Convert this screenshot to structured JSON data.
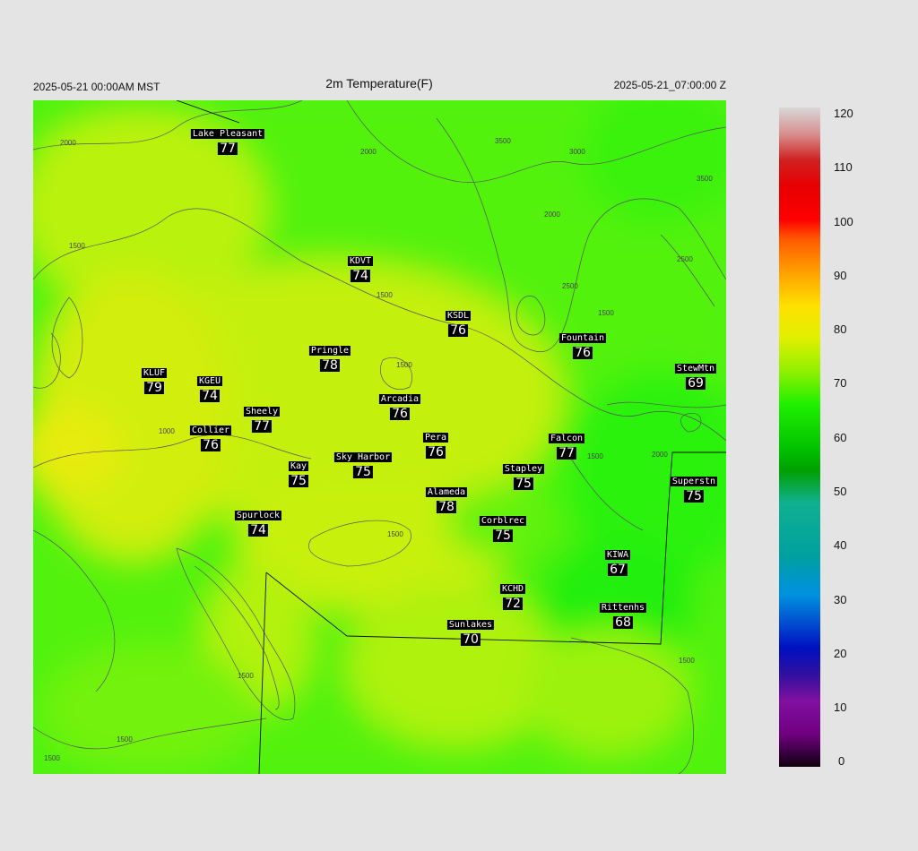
{
  "header": {
    "left_time": "2025-05-21 00:00AM MST",
    "title": "2m Temperature(F)",
    "right_time": "2025-05-21_07:00:00 Z"
  },
  "colorbar": {
    "ticks": [
      "120",
      "110",
      "100",
      "90",
      "80",
      "70",
      "60",
      "50",
      "40",
      "30",
      "20",
      "10",
      "0"
    ]
  },
  "contour_labels": [
    "2000",
    "2000",
    "3500",
    "3000",
    "1500",
    "1500",
    "2000",
    "2500",
    "3500",
    "2500",
    "1500",
    "1500",
    "1000",
    "2000",
    "1500",
    "1500",
    "1500",
    "1500",
    "1500",
    "1500"
  ],
  "stations": [
    {
      "name": "Lake Pleasant",
      "value": "77"
    },
    {
      "name": "KDVT",
      "value": "74"
    },
    {
      "name": "KSDL",
      "value": "76"
    },
    {
      "name": "Pringle",
      "value": "78"
    },
    {
      "name": "Fountain",
      "value": "76"
    },
    {
      "name": "KLUF",
      "value": "79"
    },
    {
      "name": "KGEU",
      "value": "74"
    },
    {
      "name": "StewMtn",
      "value": "69"
    },
    {
      "name": "Arcadia",
      "value": "76"
    },
    {
      "name": "Sheely",
      "value": "77"
    },
    {
      "name": "Collier",
      "value": "76"
    },
    {
      "name": "Pera",
      "value": "76"
    },
    {
      "name": "Falcon",
      "value": "77"
    },
    {
      "name": "Kay",
      "value": "75"
    },
    {
      "name": "Sky Harbor",
      "value": "75"
    },
    {
      "name": "Stapley",
      "value": "75"
    },
    {
      "name": "Superstn",
      "value": "75"
    },
    {
      "name": "Alameda",
      "value": "78"
    },
    {
      "name": "Spurlock",
      "value": "74"
    },
    {
      "name": "Corblrec",
      "value": "75"
    },
    {
      "name": "KIWA",
      "value": "67"
    },
    {
      "name": "KCHD",
      "value": "72"
    },
    {
      "name": "Rittenhs",
      "value": "68"
    },
    {
      "name": "Sunlakes",
      "value": "70"
    }
  ]
}
